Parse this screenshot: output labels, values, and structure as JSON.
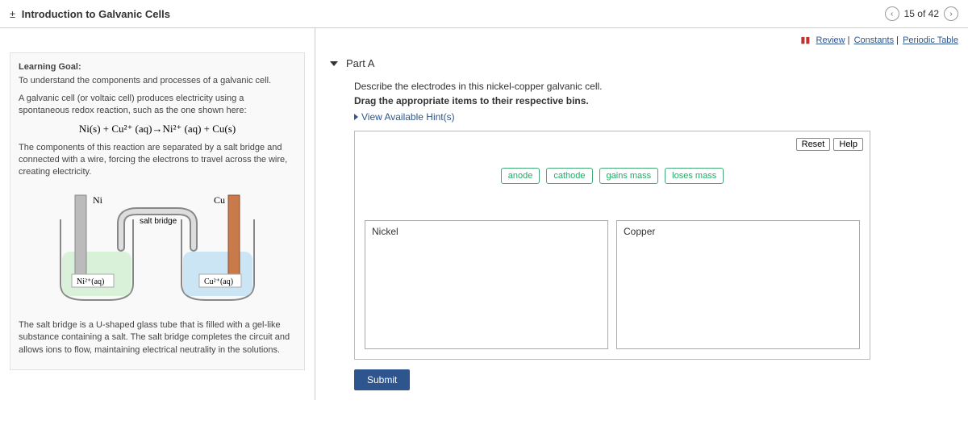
{
  "header": {
    "title": "Introduction to Galvanic Cells",
    "toggle_icon": "±",
    "progress": "15 of 42"
  },
  "review_links": {
    "review": "Review",
    "constants": "Constants",
    "periodic": "Periodic Table"
  },
  "left": {
    "heading": "Learning Goal:",
    "goal_text": "To understand the components and processes of a galvanic cell.",
    "p1": "A galvanic cell (or voltaic cell) produces electricity using a spontaneous redox reaction, such as the one shown here:",
    "equation": "Ni(s) + Cu²⁺ (aq)→Ni²⁺ (aq) + Cu(s)",
    "p2": "The components of this reaction are separated by a salt bridge and connected with a wire, forcing the electrons to travel across the wire, creating electricity.",
    "p3": "The salt bridge is a U-shaped glass tube that is filled with a gel-like substance containing a salt. The salt bridge completes the circuit and allows ions to flow, maintaining electrical neutrality in the solutions.",
    "diagram": {
      "ni_label": "Ni",
      "cu_label": "Cu",
      "salt_bridge": "salt bridge",
      "ni_sol": "Ni²⁺(aq)",
      "cu_sol": "Cu²⁺(aq)"
    }
  },
  "right": {
    "part_label": "Part A",
    "instr1": "Describe the electrodes in this nickel-copper galvanic cell.",
    "instr2": "Drag the appropriate items to their respective bins.",
    "hints": "View Available Hint(s)",
    "reset": "Reset",
    "help": "Help",
    "chips": [
      "anode",
      "cathode",
      "gains mass",
      "loses mass"
    ],
    "bins": {
      "nickel": "Nickel",
      "copper": "Copper"
    },
    "submit": "Submit"
  }
}
